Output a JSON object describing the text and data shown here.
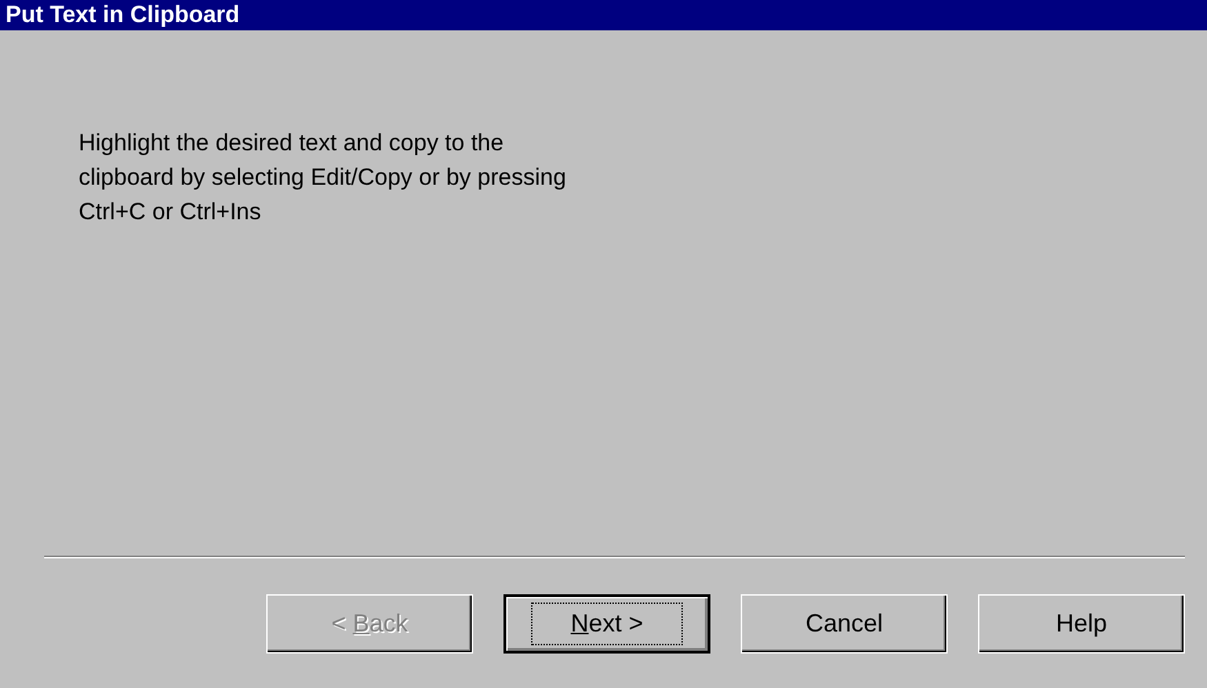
{
  "window": {
    "title": "Put Text in Clipboard"
  },
  "instructions": [
    "Highlight the desired text and copy to the",
    "clipboard by selecting Edit/Copy or by pressing",
    "Ctrl+C or Ctrl+Ins"
  ],
  "buttons": [
    {
      "before": "< ",
      "mnemonic": "B",
      "after": "ack",
      "disabled": true,
      "default": false
    },
    {
      "mnemonic": "N",
      "after": "ext >",
      "disabled": false,
      "default": true
    },
    {
      "before": "Cancel",
      "disabled": false,
      "default": false
    },
    {
      "before": "Help",
      "disabled": false,
      "default": false
    }
  ]
}
